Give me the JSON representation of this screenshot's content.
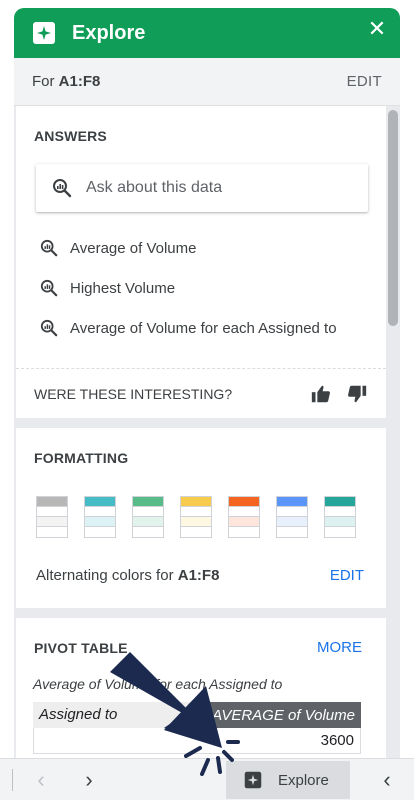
{
  "header": {
    "title": "Explore",
    "close_icon": "close-icon"
  },
  "subheader": {
    "prefix": "For",
    "range": "A1:F8",
    "edit_label": "EDIT"
  },
  "answers": {
    "title": "ANSWERS",
    "search_placeholder": "Ask about this data",
    "suggestions": [
      "Average of Volume",
      "Highest Volume",
      "Average of Volume for each Assigned to"
    ],
    "feedback_question": "WERE THESE INTERESTING?"
  },
  "formatting": {
    "title": "FORMATTING",
    "swatch_colors": [
      "#b7b7b7",
      "#46bdc6",
      "#57bb8a",
      "#f7cb4d",
      "#f46524",
      "#5b95f9",
      "#26a69a"
    ],
    "swatch_tints": [
      "#f3f3f3",
      "#ddf2f4",
      "#e2f3eb",
      "#fef8e3",
      "#ffe6dd",
      "#e8f0fe",
      "#ddf2f0"
    ],
    "caption_prefix": "Alternating colors for",
    "caption_range": "A1:F8",
    "edit_label": "EDIT"
  },
  "pivot": {
    "title": "PIVOT TABLE",
    "more_label": "MORE",
    "subtitle": "Average of Volume for each Assigned to",
    "col1": "Assigned to",
    "col2": "AVERAGE of Volume",
    "row_value": "3600"
  },
  "bottom_bar": {
    "explore_label": "Explore"
  },
  "colors": {
    "header_green": "#0f9d58",
    "link_blue": "#1a73e8",
    "arrow_navy": "#1b2a4e"
  }
}
